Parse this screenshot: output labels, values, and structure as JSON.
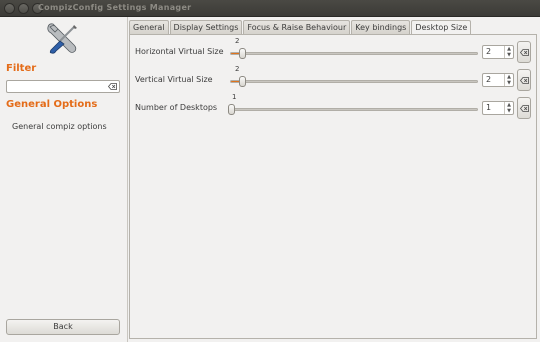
{
  "window": {
    "title": "CompizConfig Settings Manager"
  },
  "sidebar": {
    "app_icon": "screwdriver-wrench-icon",
    "filter_heading": "Filter",
    "filter_value": "",
    "filter_clear_icon": "clear-text-icon",
    "general_heading": "General Options",
    "items": [
      {
        "label": "General compiz options"
      }
    ],
    "back_label": "Back"
  },
  "tabs": [
    {
      "label": "General",
      "active": false
    },
    {
      "label": "Display Settings",
      "active": false
    },
    {
      "label": "Focus & Raise Behaviour",
      "active": false
    },
    {
      "label": "Key bindings",
      "active": false
    },
    {
      "label": "Desktop Size",
      "active": true
    }
  ],
  "settings": [
    {
      "label": "Horizontal Virtual Size",
      "value": "2",
      "slider_fraction": 0.03,
      "reset_icon": "clear-text-icon"
    },
    {
      "label": "Vertical Virtual Size",
      "value": "2",
      "slider_fraction": 0.03,
      "reset_icon": "clear-text-icon"
    },
    {
      "label": "Number of Desktops",
      "value": "1",
      "slider_fraction": 0.0,
      "reset_icon": "clear-text-icon"
    }
  ],
  "colors": {
    "accent": "#e46c19",
    "slider_fill": "#e0731c"
  }
}
